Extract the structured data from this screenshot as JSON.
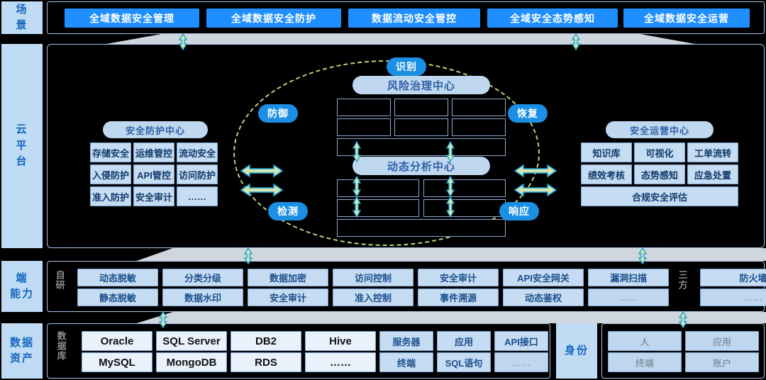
{
  "colors": {
    "accent_blue": "#1f8fff",
    "pill_blue": "#1a8fe3",
    "cell_blue": "#c5dcf2",
    "rail_blue": "#bfdcf4",
    "panel_black": "#000000",
    "ring_green": "#bcd47a",
    "arrow_fill": "#d6e6ae",
    "arrow_stroke": "#1aa3d8",
    "trapezoid_gray": "#cfd6dd"
  },
  "rails": [
    {
      "id": "scene",
      "label": "场景",
      "chars": [
        "场",
        "景"
      ]
    },
    {
      "id": "cloud",
      "label": "云平台",
      "chars": [
        "云",
        "平",
        "台"
      ]
    },
    {
      "id": "edge",
      "label": "端能力",
      "chars": [
        "端",
        "能力"
      ]
    },
    {
      "id": "assets",
      "label": "数据资产",
      "chars": [
        "数据",
        "资产"
      ]
    }
  ],
  "scene": {
    "buttons": [
      "全域数据安全管理",
      "全域数据安全防护",
      "数据流动安全管控",
      "全域安全态势感知",
      "全域数据安全运营"
    ]
  },
  "cloud": {
    "protection_center": {
      "title": "安全防护中心",
      "cells": [
        [
          "存储安全",
          "运维管控",
          "流动安全"
        ],
        [
          "入侵防护",
          "API管控",
          "访问防护"
        ],
        [
          "准入防护",
          "安全审计",
          "……"
        ]
      ]
    },
    "operation_center": {
      "title": "安全运营中心",
      "cells": [
        [
          "知识库",
          "可视化",
          "工单流转"
        ],
        [
          "绩效考核",
          "态势感知",
          "应急处置"
        ]
      ],
      "wide_cell": "合规安全评估"
    },
    "ring_labels": [
      {
        "id": "identify",
        "label": "识别"
      },
      {
        "id": "protect",
        "label": "防御"
      },
      {
        "id": "recover",
        "label": "恢复"
      },
      {
        "id": "detect",
        "label": "检测"
      },
      {
        "id": "respond",
        "label": "响应"
      }
    ],
    "hubs": [
      {
        "id": "risk-governance",
        "title": "风险治理中心",
        "rows": 2,
        "cols": 3,
        "footer_box": true
      },
      {
        "id": "dynamic-analysis",
        "title": "动态分析中心",
        "rows": 2,
        "cols": 2,
        "footer_box": true
      }
    ]
  },
  "edge": {
    "side_label_left": "自研",
    "side_label_right": "三方",
    "self_groups": [
      {
        "top": "动态脱敏",
        "bottom": "静态脱敏"
      },
      {
        "top": "分类分级",
        "bottom": "数据水印"
      },
      {
        "top": "数据加密",
        "bottom": "安全审计"
      },
      {
        "top": "访问控制",
        "bottom": "准入控制"
      },
      {
        "top": "安全审计",
        "bottom": "事件溯源"
      },
      {
        "top": "API安全网关",
        "bottom": "动态鉴权"
      },
      {
        "top": "漏洞扫描",
        "bottom": "……"
      }
    ],
    "third_party_groups": [
      {
        "top": "防火墙",
        "bottom": "……"
      }
    ]
  },
  "assets": {
    "side_label_db": "数据库",
    "identity_label": "身份",
    "db_groups": [
      {
        "top": "Oracle",
        "bottom": "MySQL"
      },
      {
        "top": "SQL Server",
        "bottom": "MongoDB"
      },
      {
        "top": "DB2",
        "bottom": "RDS"
      },
      {
        "top": "Hive",
        "bottom": "……"
      }
    ],
    "app_groups": [
      {
        "top": "服务器",
        "bottom": "终端"
      },
      {
        "top": "应用",
        "bottom": "SQL语句"
      },
      {
        "top": "API接口",
        "bottom": "……"
      }
    ],
    "identity_groups": [
      {
        "top": "人",
        "bottom": "终端"
      },
      {
        "top": "应用",
        "bottom": "账户"
      }
    ]
  }
}
